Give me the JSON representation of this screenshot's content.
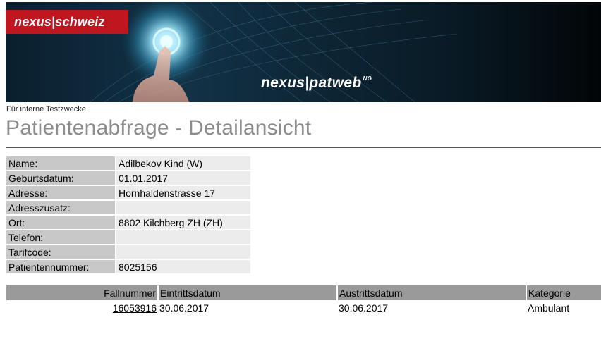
{
  "header": {
    "brand": "nexus|schweiz",
    "product": "nexus|patweb",
    "product_sup": "NG"
  },
  "subtitle": "Für interne Testzwecke",
  "title": "Patientenabfrage - Detailansicht",
  "patient": [
    {
      "label": "Name:",
      "value": "Adilbekov  Kind  (W)"
    },
    {
      "label": "Geburtsdatum:",
      "value": "01.01.2017"
    },
    {
      "label": "Adresse:",
      "value": "Hornhaldenstrasse 17"
    },
    {
      "label": "Adresszusatz:",
      "value": ""
    },
    {
      "label": "Ort:",
      "value": "8802 Kilchberg ZH (ZH)"
    },
    {
      "label": "Telefon:",
      "value": ""
    },
    {
      "label": "Tarifcode:",
      "value": ""
    },
    {
      "label": "Patientennummer:",
      "value": "8025156"
    }
  ],
  "cases": {
    "headers": [
      "Fallnummer",
      "Eintrittsdatum",
      "Austrittsdatum",
      "Kategorie"
    ],
    "rows": [
      [
        "16053916",
        "30.06.2017",
        "30.06.2017",
        "Ambulant"
      ]
    ]
  },
  "colors": {
    "brand_red": "#c0161f",
    "title_gray": "#8c8c8c",
    "label_bg": "#c8c8c8",
    "value_bg": "#ececec",
    "header_bg": "#9a9a9a"
  }
}
